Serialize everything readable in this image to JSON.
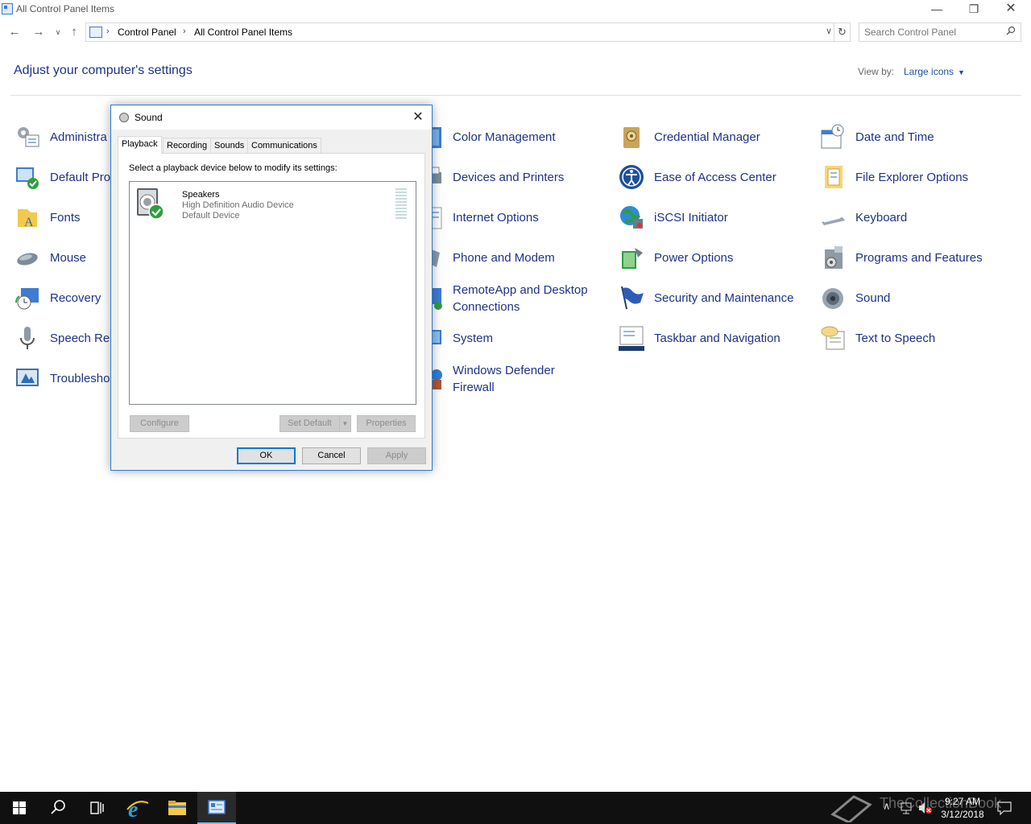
{
  "window": {
    "title": "All Control Panel Items"
  },
  "address": {
    "crumbs": [
      "Control Panel",
      "All Control Panel Items"
    ],
    "separator": "›"
  },
  "search": {
    "placeholder": "Search Control Panel"
  },
  "header": {
    "title": "Adjust your computer's settings",
    "view_by_label": "View by:",
    "view_by_value": "Large icons"
  },
  "items": {
    "administrative_tools": "Administra",
    "default_programs": "Default Pro",
    "fonts": "Fonts",
    "mouse": "Mouse",
    "recovery": "Recovery",
    "speech_recognition": "Speech Rec",
    "troubleshooting": "Troublesho",
    "color_management": "Color Management",
    "devices_and_printers": "Devices and Printers",
    "internet_options": "Internet Options",
    "phone_and_modem": "Phone and Modem",
    "remoteapp_line1": "RemoteApp and Desktop",
    "remoteapp_line2": "Connections",
    "system": "System",
    "firewall_line1": "Windows Defender",
    "firewall_line2": "Firewall",
    "credential_manager": "Credential Manager",
    "ease_of_access": "Ease of Access Center",
    "iscsi_initiator": "iSCSI Initiator",
    "power_options": "Power Options",
    "security_and_maintenance": "Security and Maintenance",
    "taskbar_and_navigation": "Taskbar and Navigation",
    "date_and_time": "Date and Time",
    "file_explorer_options": "File Explorer Options",
    "keyboard": "Keyboard",
    "programs_and_features": "Programs and Features",
    "sound": "Sound",
    "text_to_speech": "Text to Speech"
  },
  "dialog": {
    "title": "Sound",
    "tabs": [
      "Playback",
      "Recording",
      "Sounds",
      "Communications"
    ],
    "instruction": "Select a playback device below to modify its settings:",
    "device": {
      "name": "Speakers",
      "line2": "High Definition Audio Device",
      "line3": "Default Device"
    },
    "buttons": {
      "configure": "Configure",
      "set_default": "Set Default",
      "properties": "Properties",
      "ok": "OK",
      "cancel": "Cancel",
      "apply": "Apply"
    }
  },
  "taskbar": {
    "time": "9:27 AM",
    "date": "3/12/2018",
    "watermark": "TheCollectionBook"
  },
  "colors": {
    "link": "#1e3287",
    "accent": "#0078d7",
    "taskbar": "#101010"
  }
}
